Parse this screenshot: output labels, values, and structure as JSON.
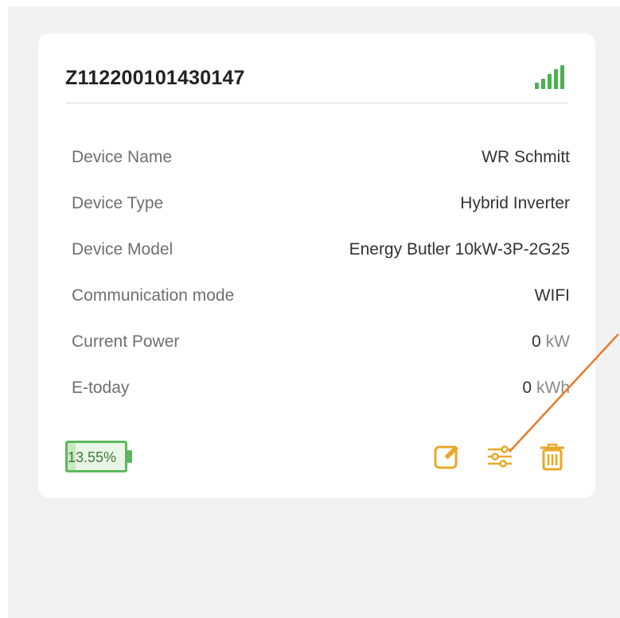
{
  "device": {
    "serial": "Z112200101430147",
    "rows": [
      {
        "label": "Device Name",
        "value": "WR Schmitt",
        "unit": ""
      },
      {
        "label": "Device Type",
        "value": "Hybrid Inverter",
        "unit": ""
      },
      {
        "label": "Device Model",
        "value": "Energy Butler 10kW-3P-2G25",
        "unit": ""
      },
      {
        "label": "Communication mode",
        "value": "WIFI",
        "unit": ""
      },
      {
        "label": "Current Power",
        "value": "0",
        "unit": "kW"
      },
      {
        "label": "E-today",
        "value": "0",
        "unit": "kWh"
      }
    ],
    "battery": {
      "text": "13.55%",
      "level": 0.1355
    }
  },
  "icons": {
    "signal": "signal-strength-icon",
    "edit": "edit-icon",
    "settings": "settings-sliders-icon",
    "delete": "trash-icon"
  },
  "colors": {
    "accent": "#e8a82a",
    "signal": "#4caf50",
    "battery": "#5cb85c",
    "annotation_arrow": "#e87a2a"
  }
}
